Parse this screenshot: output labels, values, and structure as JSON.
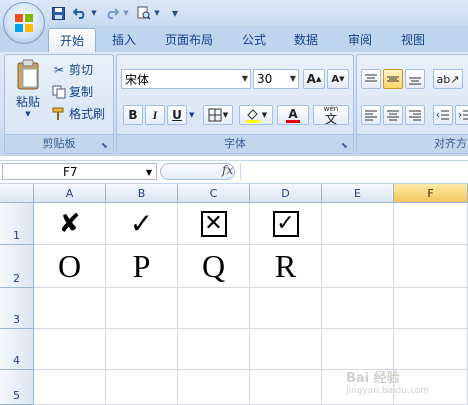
{
  "quick_access": {
    "save_icon": "save-icon",
    "undo_icon": "undo-icon",
    "redo_icon": "redo-icon",
    "print_preview_icon": "print-preview-icon",
    "customize_glyph": "▾"
  },
  "tabs": [
    {
      "label": "开始",
      "active": true
    },
    {
      "label": "插入"
    },
    {
      "label": "页面布局"
    },
    {
      "label": "公式"
    },
    {
      "label": "数据"
    },
    {
      "label": "审阅"
    },
    {
      "label": "视图"
    }
  ],
  "clipboard": {
    "paste_label": "粘贴",
    "cut_label": "剪切",
    "copy_label": "复制",
    "format_painter_label": "格式刷",
    "group_label": "剪贴板"
  },
  "font": {
    "name": "宋体",
    "size": "30",
    "grow_label": "A",
    "shrink_label": "A",
    "bold_label": "B",
    "italic_label": "I",
    "underline_label": "U",
    "font_color_letter": "A",
    "wen_label": "文",
    "wen_top": "wén",
    "group_label": "字体"
  },
  "alignment": {
    "group_label": "对齐方"
  },
  "formula_bar": {
    "name_box": "F7",
    "fx_label": "fx"
  },
  "columns": [
    "A",
    "B",
    "C",
    "D",
    "E",
    "F"
  ],
  "selected_column": "F",
  "rows": [
    "1",
    "2",
    "3",
    "4",
    "5"
  ],
  "cells": {
    "A1": "✘",
    "B1": "✓",
    "C1": "✕",
    "D1": "✓",
    "A2": "O",
    "B2": "P",
    "C2": "Q",
    "D2": "R"
  },
  "watermark": {
    "line1": "Bai 经验",
    "line2": "jingyan.baidu.com"
  },
  "colors": {
    "tab_text": "#15428b",
    "selected_column_fill": "#f5c45c",
    "ribbon_bg": "#d0def0"
  }
}
